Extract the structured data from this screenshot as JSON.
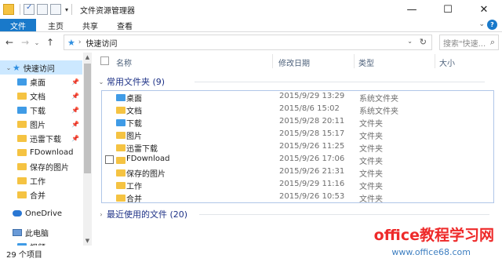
{
  "window": {
    "title": "文件资源管理器",
    "minimize": "—",
    "maximize": "☐",
    "close": "✕"
  },
  "ribbon": {
    "tabs": [
      "文件",
      "主页",
      "共享",
      "查看"
    ],
    "expand_icon": "chevron-down-icon",
    "help_icon": "help-icon"
  },
  "address": {
    "path": "快速访问",
    "search_placeholder": "搜索\"快速...",
    "refresh_icon": "refresh-icon"
  },
  "nav": {
    "items": [
      {
        "label": "快速访问",
        "icon": "star-icon",
        "selected": true
      },
      {
        "label": "桌面",
        "icon": "desktop-folder-icon",
        "pinned": true
      },
      {
        "label": "文档",
        "icon": "documents-folder-icon",
        "pinned": true
      },
      {
        "label": "下载",
        "icon": "downloads-folder-icon",
        "pinned": true
      },
      {
        "label": "图片",
        "icon": "pictures-folder-icon",
        "pinned": true
      },
      {
        "label": "迅雷下载",
        "icon": "folder-icon",
        "pinned": true
      },
      {
        "label": "FDownload",
        "icon": "folder-icon"
      },
      {
        "label": "保存的图片",
        "icon": "folder-icon"
      },
      {
        "label": "工作",
        "icon": "folder-icon"
      },
      {
        "label": "合并",
        "icon": "folder-icon"
      },
      {
        "label": "OneDrive",
        "icon": "onedrive-icon"
      },
      {
        "label": "此电脑",
        "icon": "computer-icon"
      },
      {
        "label": "视频",
        "icon": "videos-folder-icon"
      }
    ]
  },
  "columns": {
    "name": "名称",
    "date": "修改日期",
    "type": "类型",
    "size": "大小"
  },
  "groups": {
    "frequent": "常用文件夹 (9)",
    "recent": "最近使用的文件 (20)"
  },
  "folders": [
    {
      "name": "桌面",
      "date": "2015/9/29 13:29",
      "type": "系统文件夹",
      "icon": "desktop-folder-icon"
    },
    {
      "name": "文档",
      "date": "2015/8/6 15:02",
      "type": "系统文件夹",
      "icon": "documents-folder-icon"
    },
    {
      "name": "下载",
      "date": "2015/9/28 20:11",
      "type": "文件夹",
      "icon": "downloads-folder-icon"
    },
    {
      "name": "图片",
      "date": "2015/9/28 15:17",
      "type": "文件夹",
      "icon": "pictures-folder-icon"
    },
    {
      "name": "迅雷下载",
      "date": "2015/9/26 11:25",
      "type": "文件夹",
      "icon": "folder-icon"
    },
    {
      "name": "FDownload",
      "date": "2015/9/26 17:06",
      "type": "文件夹",
      "icon": "folder-icon"
    },
    {
      "name": "保存的图片",
      "date": "2015/9/26 21:31",
      "type": "文件夹",
      "icon": "folder-icon"
    },
    {
      "name": "工作",
      "date": "2015/9/29 11:16",
      "type": "文件夹",
      "icon": "folder-icon"
    },
    {
      "name": "合并",
      "date": "2015/9/26 10:53",
      "type": "文件夹",
      "icon": "folder-icon"
    }
  ],
  "status": {
    "count": "29 个项目"
  },
  "watermark": {
    "text": "office教程学习网",
    "url": "www.office68.com"
  },
  "colors": {
    "accent": "#1979ca",
    "folder": "#f5c342",
    "selection": "#cce8ff",
    "group_heading": "#1e3287"
  }
}
